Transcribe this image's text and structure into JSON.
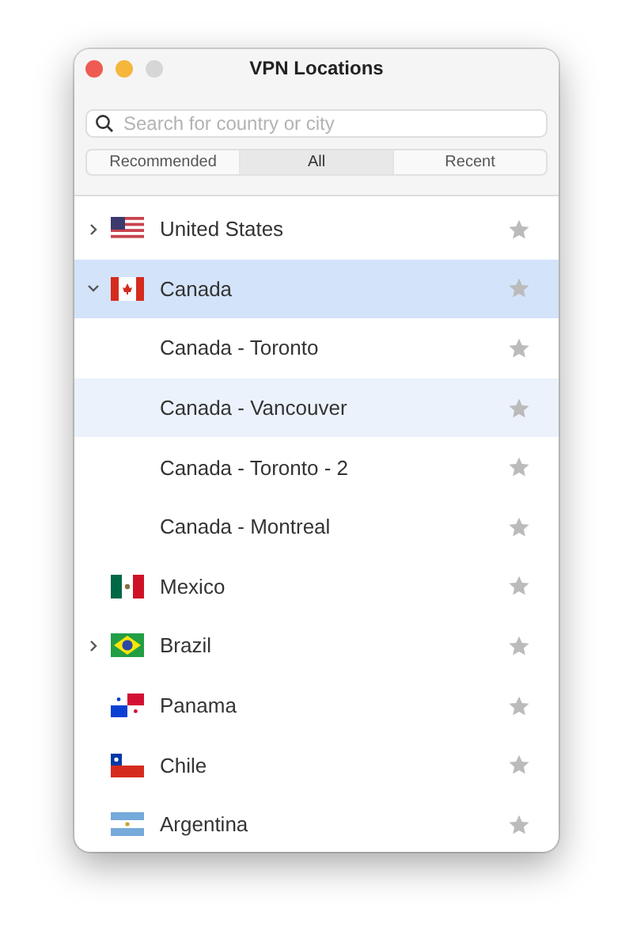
{
  "window": {
    "title": "VPN Locations"
  },
  "search": {
    "placeholder": "Search for country or city"
  },
  "tabs": [
    {
      "label": "Recommended",
      "selected": false
    },
    {
      "label": "All",
      "selected": true
    },
    {
      "label": "Recent",
      "selected": false
    }
  ],
  "locations": [
    {
      "name": "United States",
      "kind": "us",
      "expandable": true,
      "expanded": false,
      "selected": false,
      "highlighted": false
    },
    {
      "name": "Canada",
      "kind": "ca",
      "expandable": true,
      "expanded": true,
      "selected": true,
      "highlighted": false,
      "children": [
        {
          "name": "Canada - Toronto",
          "selected": false,
          "highlighted": false
        },
        {
          "name": "Canada - Vancouver",
          "selected": false,
          "highlighted": true
        },
        {
          "name": "Canada - Toronto - 2",
          "selected": false,
          "highlighted": false
        },
        {
          "name": "Canada - Montreal",
          "selected": false,
          "highlighted": false
        }
      ]
    },
    {
      "name": "Mexico",
      "kind": "mx",
      "expandable": false,
      "selected": false,
      "highlighted": false
    },
    {
      "name": "Brazil",
      "kind": "br",
      "expandable": true,
      "expanded": false,
      "selected": false,
      "highlighted": false
    },
    {
      "name": "Panama",
      "kind": "pa",
      "expandable": false,
      "selected": false,
      "highlighted": false
    },
    {
      "name": "Chile",
      "kind": "cl",
      "expandable": false,
      "selected": false,
      "highlighted": false
    },
    {
      "name": "Argentina",
      "kind": "ar",
      "expandable": false,
      "selected": false,
      "highlighted": false
    }
  ]
}
